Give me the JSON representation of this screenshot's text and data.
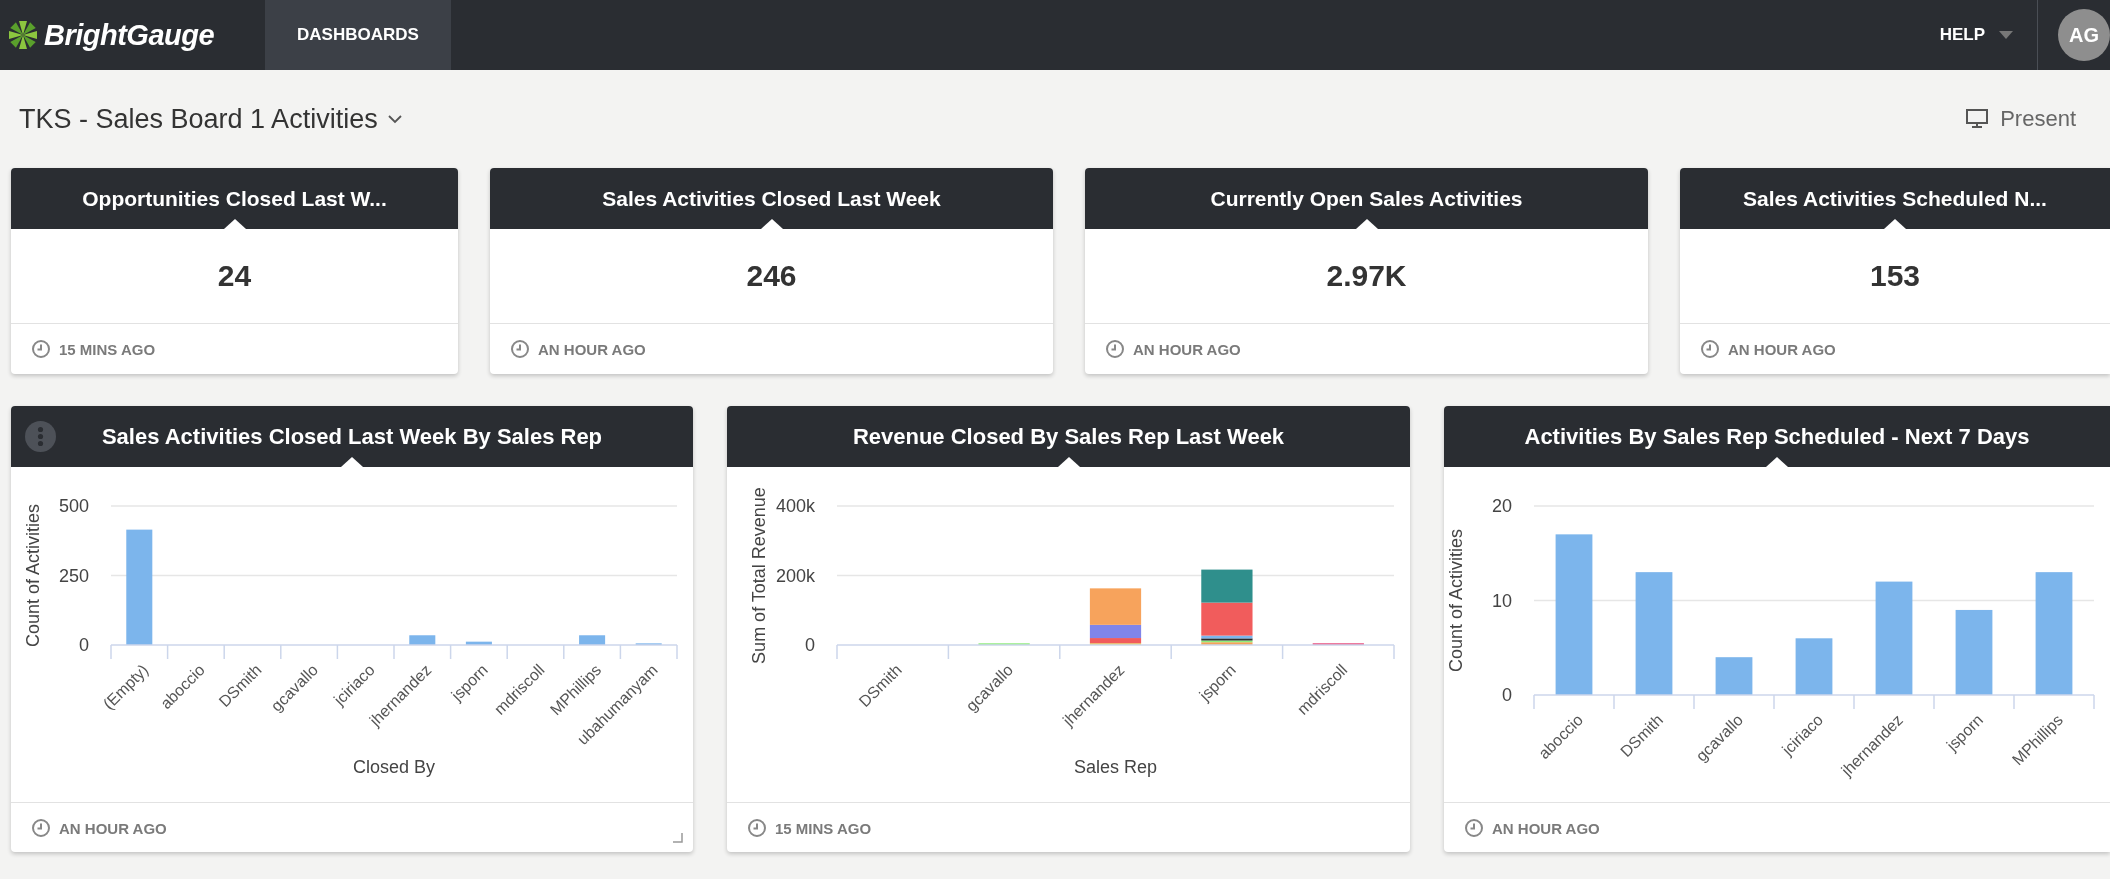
{
  "navbar": {
    "logo": "BrightGauge",
    "tabs": [
      {
        "label": "DASHBOARDS",
        "selected": true
      }
    ],
    "help": "HELP",
    "avatar": "AG"
  },
  "dashboard": {
    "title": "TKS - Sales Board 1 Activities",
    "present": "Present"
  },
  "stat_gauges": [
    {
      "title": "Opportunities Closed Last W...",
      "value": "24",
      "updated": "15 MINS AGO"
    },
    {
      "title": "Sales Activities Closed Last Week",
      "value": "246",
      "updated": "AN HOUR AGO"
    },
    {
      "title": "Currently Open Sales Activities",
      "value": "2.97K",
      "updated": "AN HOUR AGO"
    },
    {
      "title": "Sales Activities Scheduled N...",
      "value": "153",
      "updated": "AN HOUR AGO"
    }
  ],
  "chart_gauges": [
    {
      "title": "Sales Activities Closed Last Week By Sales Rep",
      "hovered": true,
      "updated": "AN HOUR AGO",
      "chart_data": {
        "type": "bar",
        "xlabel": "Closed By",
        "ylabel": "Count of Activities",
        "categories": [
          "(Empty)",
          "aboccio",
          "DSmith",
          "gcavallo",
          "jciriaco",
          "jhernandez",
          "jsporn",
          "mdriscoll",
          "MPhillips",
          "ubahumanyam"
        ],
        "series": [
          {
            "color": "#7cb5ec",
            "values": [
              415,
              0,
              0,
              0,
              0,
              35,
              12,
              0,
              35,
              6
            ]
          }
        ],
        "ylim": [
          0,
          500
        ],
        "yticks": [
          0,
          250,
          500
        ]
      }
    },
    {
      "title": "Revenue Closed By Sales Rep Last Week",
      "hovered": false,
      "updated": "15 MINS AGO",
      "chart_data": {
        "type": "bar",
        "stacked": true,
        "xlabel": "Sales Rep",
        "ylabel": "Sum of Total Revenue",
        "categories": [
          "DSmith",
          "gcavallo",
          "jhernandez",
          "jsporn",
          "mdriscoll"
        ],
        "series": [
          {
            "color": "#f4a259",
            "values": [
              0,
              0,
              0,
              8000,
              0
            ]
          },
          {
            "color": "#90ed7d",
            "values": [
              0,
              5000,
              0,
              5000,
              0
            ]
          },
          {
            "color": "#e4d354",
            "values": [
              0,
              0,
              5000,
              0,
              0
            ]
          },
          {
            "color": "#2b2b2b",
            "values": [
              0,
              0,
              0,
              6000,
              0
            ]
          },
          {
            "color": "#7cb5ec",
            "values": [
              0,
              0,
              0,
              8000,
              0
            ]
          },
          {
            "color": "#f15c5c",
            "values": [
              0,
              0,
              15000,
              95000,
              0
            ]
          },
          {
            "color": "#e84c7d",
            "values": [
              0,
              0,
              0,
              0,
              5000
            ]
          },
          {
            "color": "#8085e9",
            "values": [
              0,
              0,
              38000,
              0,
              0
            ]
          },
          {
            "color": "#f7a35c",
            "values": [
              0,
              0,
              105000,
              0,
              0
            ]
          },
          {
            "color": "#2f8f8c",
            "values": [
              0,
              0,
              0,
              95000,
              0
            ]
          }
        ],
        "ylim": [
          0,
          400000
        ],
        "yticks": [
          0,
          {
            "value": 200000,
            "label": "200k"
          },
          {
            "value": 400000,
            "label": "400k"
          }
        ]
      }
    },
    {
      "title": "Activities By Sales Rep Scheduled - Next 7 Days",
      "hovered": false,
      "updated": "AN HOUR AGO",
      "chart_data": {
        "type": "bar",
        "ylabel": "Count of Activities",
        "categories": [
          "aboccio",
          "DSmith",
          "gcavallo",
          "jciriaco",
          "jhernandez",
          "jsporn",
          "MPhillips"
        ],
        "series": [
          {
            "color": "#7cb5ec",
            "values": [
              17,
              13,
              4,
              6,
              12,
              9,
              13
            ]
          }
        ],
        "ylim": [
          0,
          20
        ],
        "yticks": [
          0,
          10,
          20
        ]
      }
    }
  ]
}
